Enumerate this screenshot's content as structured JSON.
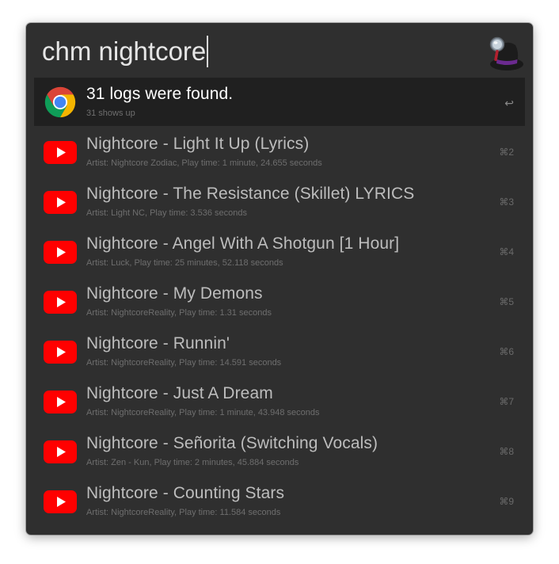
{
  "search": {
    "query": "chm nightcore"
  },
  "results": [
    {
      "icon": "chrome-icon",
      "title": "31 logs were found.",
      "subtitle": "31 shows up",
      "shortcut": "↩",
      "selected": true
    },
    {
      "icon": "youtube-icon",
      "title": "Nightcore - Light It Up (Lyrics)",
      "subtitle": "Artist: Nightcore Zodiac, Play time: 1 minute, 24.655 seconds",
      "shortcut": "⌘2"
    },
    {
      "icon": "youtube-icon",
      "title": "Nightcore - The Resistance (Skillet) LYRICS",
      "subtitle": "Artist: Light NC, Play time: 3.536 seconds",
      "shortcut": "⌘3"
    },
    {
      "icon": "youtube-icon",
      "title": "Nightcore - Angel With A Shotgun [1 Hour]",
      "subtitle": "Artist: Luck, Play time: 25 minutes, 52.118 seconds",
      "shortcut": "⌘4"
    },
    {
      "icon": "youtube-icon",
      "title": "Nightcore - My Demons",
      "subtitle": "Artist: NightcoreReality, Play time: 1.31 seconds",
      "shortcut": "⌘5"
    },
    {
      "icon": "youtube-icon",
      "title": "Nightcore - Runnin'",
      "subtitle": "Artist: NightcoreReality, Play time: 14.591 seconds",
      "shortcut": "⌘6"
    },
    {
      "icon": "youtube-icon",
      "title": "Nightcore - Just A Dream",
      "subtitle": "Artist: NightcoreReality, Play time: 1 minute, 43.948 seconds",
      "shortcut": "⌘7"
    },
    {
      "icon": "youtube-icon",
      "title": "Nightcore - Señorita (Switching Vocals)",
      "subtitle": "Artist: Zen - Kun, Play time: 2 minutes, 45.884 seconds",
      "shortcut": "⌘8"
    },
    {
      "icon": "youtube-icon",
      "title": "Nightcore - Counting Stars",
      "subtitle": "Artist: NightcoreReality, Play time: 11.584 seconds",
      "shortcut": "⌘9"
    }
  ],
  "colors": {
    "window_bg": "#2f2f2f",
    "selected_bg": "#202020",
    "youtube_red": "#ff0000"
  }
}
